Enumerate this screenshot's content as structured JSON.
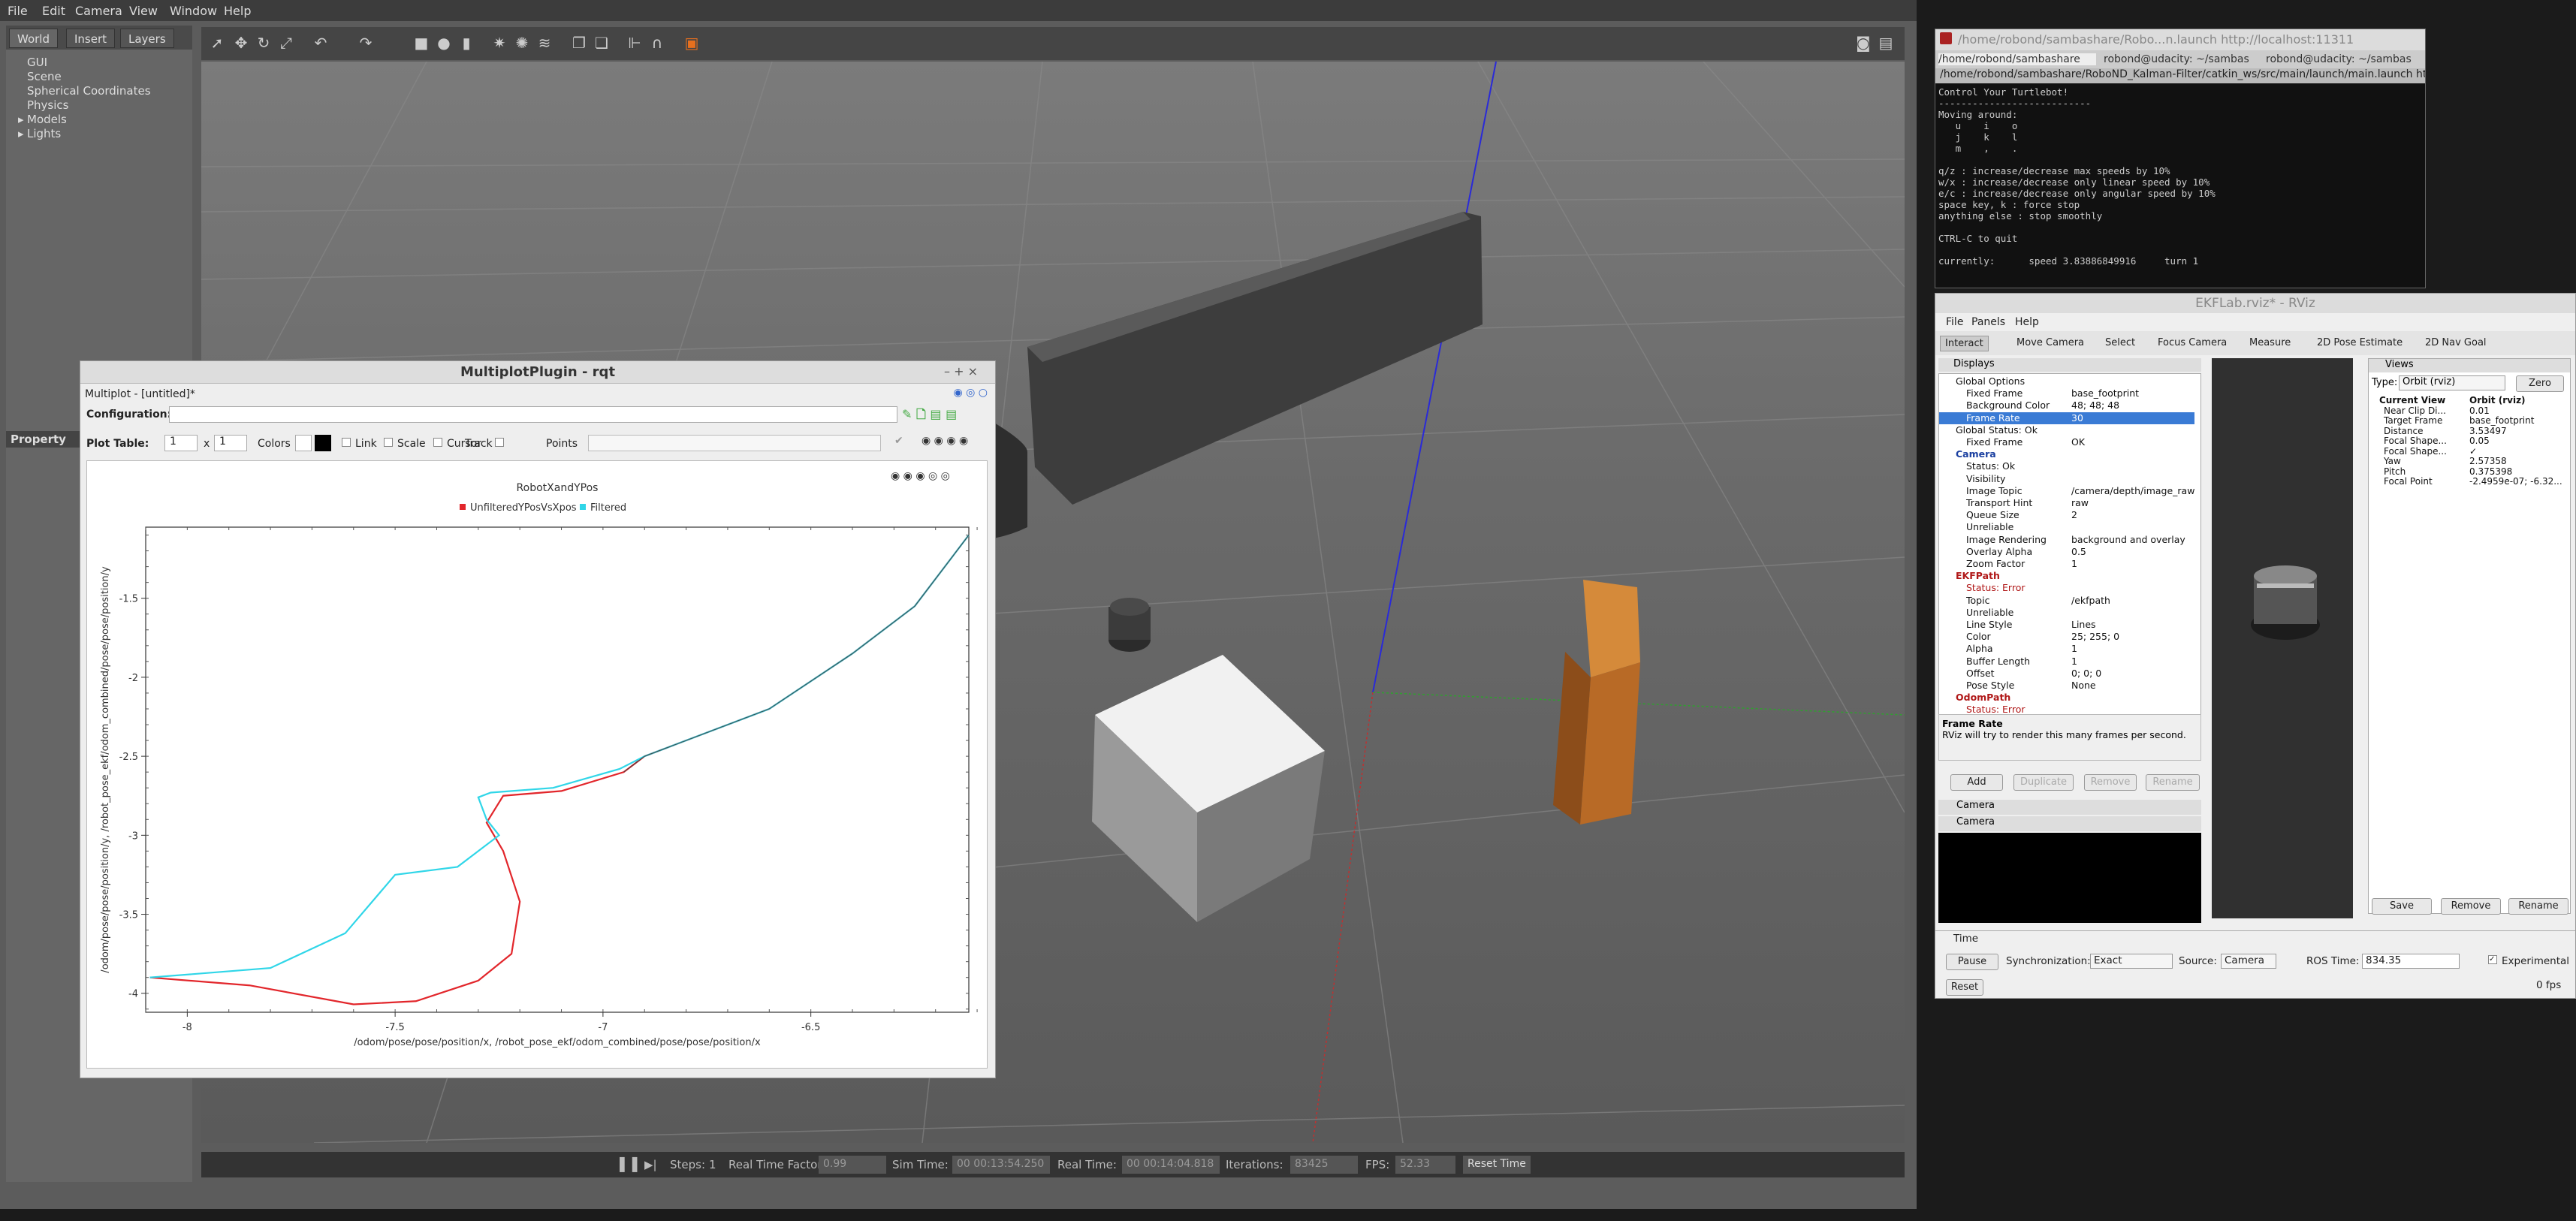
{
  "gazebo": {
    "menu": [
      "File",
      "Edit",
      "Camera",
      "View",
      "Window",
      "Help"
    ],
    "tabs": [
      "World",
      "Insert",
      "Layers"
    ],
    "tree": [
      "GUI",
      "Scene",
      "Spherical Coordinates",
      "Physics",
      "Models",
      "Lights"
    ],
    "property_label": "Property",
    "bottom": {
      "steps_label": "Steps:",
      "steps_value": "1",
      "rtf_label": "Real Time Factor:",
      "rtf_value": "0.99",
      "sim_label": "Sim Time:",
      "sim_value": "00 00:13:54.250",
      "real_label": "Real Time:",
      "real_value": "00 00:14:04.818",
      "iter_label": "Iterations:",
      "iter_value": "83425",
      "fps_label": "FPS:",
      "fps_value": "52.33",
      "reset_label": "Reset Time"
    }
  },
  "rqt": {
    "title": "MultiplotPlugin - rqt",
    "subtitle": "Multiplot - [untitled]*",
    "config_label": "Configuration:",
    "plot_table_label": "Plot Table:",
    "rows": "1",
    "x": "x",
    "cols": "1",
    "colors_label": "Colors",
    "link_label": "Link",
    "scale_label": "Scale",
    "cursor_label": "Cursor",
    "track_label": "Track",
    "points_label": "Points"
  },
  "chart_data": {
    "type": "line",
    "title": "RobotXandYPos",
    "xlabel": "/odom/pose/pose/position/x, /robot_pose_ekf/odom_combined/pose/pose/position/x",
    "ylabel": "/odom/pose/pose/position/y, /robot_pose_ekf/odom_combined/pose/pose/position/y",
    "xlim": [
      -8.1,
      -6.12
    ],
    "ylim": [
      -4.12,
      -1.05
    ],
    "xticks": [
      "-8",
      "-7.5",
      "-7",
      "-6.5"
    ],
    "yticks": [
      "-1.5",
      "-2",
      "-2.5",
      "-3",
      "-3.5",
      "-4"
    ],
    "colors": {
      "UnfilteredYPosVsXpos": "#e2262b",
      "Filtered": "#30d6e8"
    },
    "series": [
      {
        "name": "UnfilteredYPosVsXpos",
        "x": [
          -8.09,
          -7.85,
          -7.6,
          -7.45,
          -7.3,
          -7.22,
          -7.2,
          -7.24,
          -7.28,
          -7.24,
          -7.1,
          -6.95,
          -6.9,
          -6.82,
          -6.6,
          -6.4,
          -6.25,
          -6.12
        ],
        "y": [
          -3.9,
          -3.95,
          -4.07,
          -4.05,
          -3.92,
          -3.75,
          -3.42,
          -3.1,
          -2.92,
          -2.75,
          -2.72,
          -2.6,
          -2.5,
          -2.42,
          -2.2,
          -1.85,
          -1.55,
          -1.1
        ]
      },
      {
        "name": "Filtered",
        "x": [
          -8.09,
          -7.8,
          -7.62,
          -7.5,
          -7.35,
          -7.25,
          -7.28,
          -7.3,
          -7.27,
          -7.12,
          -6.96,
          -6.9,
          -6.82,
          -6.6,
          -6.4,
          -6.25,
          -6.12
        ],
        "y": [
          -3.9,
          -3.84,
          -3.62,
          -3.25,
          -3.2,
          -3.0,
          -2.9,
          -2.76,
          -2.73,
          -2.7,
          -2.58,
          -2.5,
          -2.42,
          -2.2,
          -1.85,
          -1.55,
          -1.1
        ]
      }
    ]
  },
  "terminal": {
    "title": "/home/robond/sambashare/Robo...n.launch http://localhost:11311",
    "tabs": [
      "/home/robond/sambashare",
      "robond@udacity: ~/sambas",
      "robond@udacity: ~/sambas"
    ],
    "path": "/home/robond/sambashare/RoboND_Kalman-Filter/catkin_ws/src/main/launch/main.launch http://",
    "lines": [
      "Control Your Turtlebot!",
      "---------------------------",
      "Moving around:",
      "   u    i    o",
      "   j    k    l",
      "   m    ,    .",
      "",
      "q/z : increase/decrease max speeds by 10%",
      "w/x : increase/decrease only linear speed by 10%",
      "e/c : increase/decrease only angular speed by 10%",
      "space key, k : force stop",
      "anything else : stop smoothly",
      "",
      "CTRL-C to quit",
      "",
      "currently:      speed 3.83886849916     turn 1"
    ]
  },
  "rviz": {
    "title": "EKFLab.rviz* - RViz",
    "menu": [
      "File",
      "Panels",
      "Help"
    ],
    "tools": [
      "Interact",
      "Move Camera",
      "Select",
      "Focus Camera",
      "Measure",
      "2D Pose Estimate",
      "2D Nav Goal"
    ],
    "displays_label": "Displays",
    "rows": [
      [
        "Global Options",
        ""
      ],
      [
        "Fixed Frame",
        "base_footprint"
      ],
      [
        "Background Color",
        "48; 48; 48"
      ],
      [
        "Frame Rate",
        "30"
      ],
      [
        "Global Status: Ok",
        ""
      ],
      [
        "Fixed Frame",
        "OK"
      ],
      [
        "Camera",
        ""
      ],
      [
        "Status: Ok",
        ""
      ],
      [
        "Visibility",
        ""
      ],
      [
        "Image Topic",
        "/camera/depth/image_raw"
      ],
      [
        "Transport Hint",
        "raw"
      ],
      [
        "Queue Size",
        "2"
      ],
      [
        "Unreliable",
        ""
      ],
      [
        "Image Rendering",
        "background and overlay"
      ],
      [
        "Overlay Alpha",
        "0.5"
      ],
      [
        "Zoom Factor",
        "1"
      ],
      [
        "EKFPath",
        ""
      ],
      [
        "Status: Error",
        ""
      ],
      [
        "Topic",
        "/ekfpath"
      ],
      [
        "Unreliable",
        ""
      ],
      [
        "Line Style",
        "Lines"
      ],
      [
        "Color",
        "25; 255; 0"
      ],
      [
        "Alpha",
        "1"
      ],
      [
        "Buffer Length",
        "1"
      ],
      [
        "Offset",
        "0; 0; 0"
      ],
      [
        "Pose Style",
        "None"
      ],
      [
        "OdomPath",
        ""
      ],
      [
        "Status: Error",
        ""
      ]
    ],
    "desc_title": "Frame Rate",
    "desc_text": "RViz will try to render this many frames per second.",
    "buttons": [
      "Add",
      "Duplicate",
      "Remove",
      "Rename"
    ],
    "camera_panel": "Camera",
    "views_label": "Views",
    "views_type_label": "Type:",
    "views_type_value": "Orbit (rviz)",
    "views_zero": "Zero",
    "view_rows": [
      [
        "Current View",
        "Orbit (rviz)"
      ],
      [
        "Near Clip Di...",
        "0.01"
      ],
      [
        "Target Frame",
        "base_footprint"
      ],
      [
        "Distance",
        "3.53497"
      ],
      [
        "Focal Shape...",
        "0.05"
      ],
      [
        "Focal Shape...",
        "✓"
      ],
      [
        "Yaw",
        "2.57358"
      ],
      [
        "Pitch",
        "0.375398"
      ],
      [
        "Focal Point",
        "-2.4959e-07; -6.32..."
      ]
    ],
    "view_buttons": [
      "Save",
      "Remove",
      "Rename"
    ],
    "time_label": "Time",
    "pause": "Pause",
    "sync_label": "Synchronization:",
    "sync_value": "Exact",
    "source_label": "Source:",
    "source_value": "Camera",
    "ros_time_label": "ROS Time:",
    "ros_time_value": "834.35",
    "experimental": "Experimental",
    "reset": "Reset",
    "fps": "0 fps"
  }
}
